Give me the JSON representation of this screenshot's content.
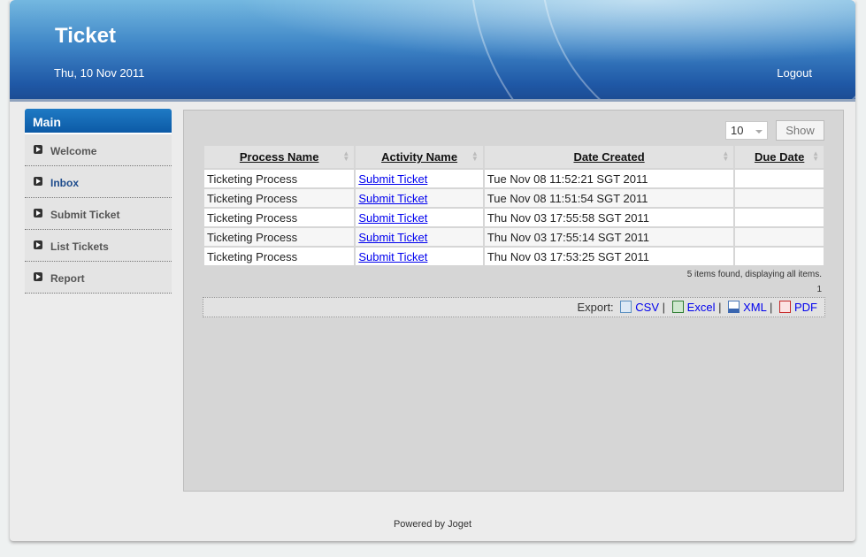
{
  "header": {
    "title": "Ticket",
    "date": "Thu, 10 Nov 2011",
    "logout": "Logout"
  },
  "sidebar": {
    "heading": "Main",
    "items": [
      {
        "label": "Welcome"
      },
      {
        "label": "Inbox"
      },
      {
        "label": "Submit Ticket"
      },
      {
        "label": "List Tickets"
      },
      {
        "label": "Report"
      }
    ]
  },
  "toolbar": {
    "page_size": "10",
    "show": "Show"
  },
  "table": {
    "headers": [
      "Process Name",
      "Activity Name",
      "Date Created",
      "Due Date"
    ],
    "rows": [
      [
        "Ticketing Process",
        "Submit Ticket",
        "Tue Nov 08 11:52:21 SGT 2011",
        ""
      ],
      [
        "Ticketing Process",
        "Submit Ticket",
        "Tue Nov 08 11:51:54 SGT 2011",
        ""
      ],
      [
        "Ticketing Process",
        "Submit Ticket",
        "Thu Nov 03 17:55:58 SGT 2011",
        ""
      ],
      [
        "Ticketing Process",
        "Submit Ticket",
        "Thu Nov 03 17:55:14 SGT 2011",
        ""
      ],
      [
        "Ticketing Process",
        "Submit Ticket",
        "Thu Nov 03 17:53:25 SGT 2011",
        ""
      ]
    ]
  },
  "pagination": {
    "found": "5 items found, displaying all items.",
    "page": "1"
  },
  "export": {
    "label": "Export:",
    "csv": "CSV",
    "excel": "Excel",
    "xml": "XML",
    "pdf": "PDF",
    "sep": "|"
  },
  "footer": "Powered by Joget"
}
